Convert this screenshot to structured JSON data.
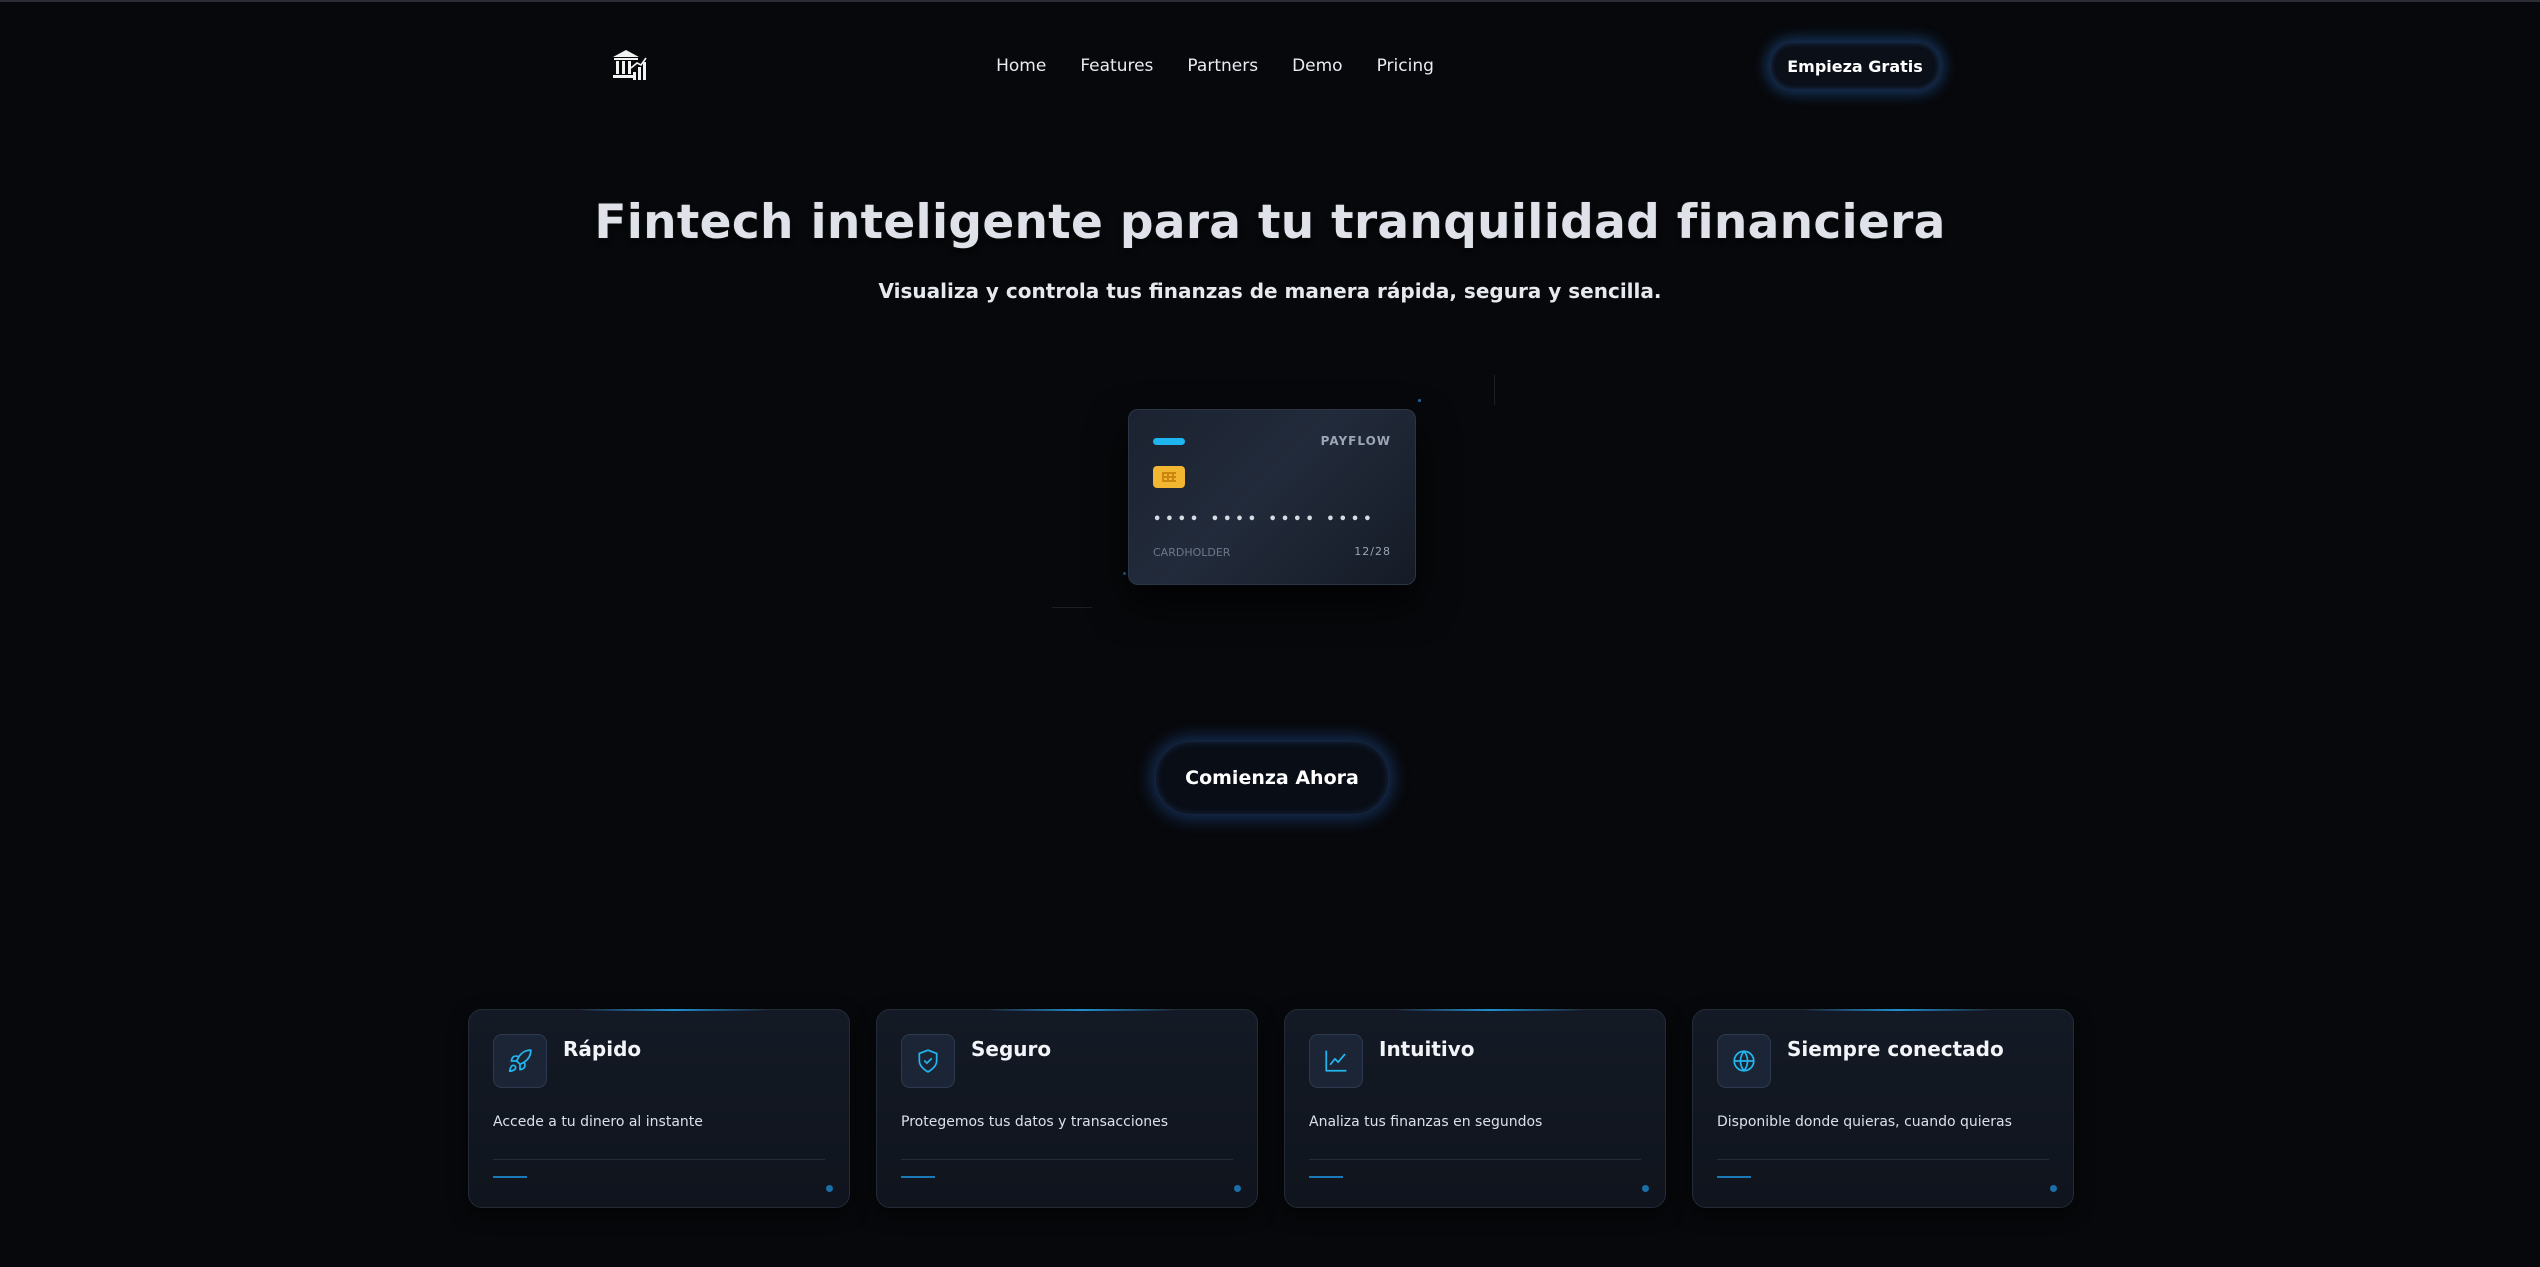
{
  "header": {
    "logo_icon": "bank-chart-icon",
    "nav": [
      "Home",
      "Features",
      "Partners",
      "Demo",
      "Pricing"
    ],
    "cta_label": "Empieza Gratis"
  },
  "hero": {
    "title": "Fintech inteligente para tu tranquilidad financiera",
    "subtitle": "Visualiza y controla tus finanzas de manera rápida, segura y sencilla."
  },
  "card": {
    "brand": "PAYFLOW",
    "number_masked": "•••• •••• •••• ••••",
    "holder": "CARDHOLDER",
    "expiry": "12/28",
    "strip_color": "#1fb6f0",
    "chip_color": "#f2b630"
  },
  "main_cta": {
    "label": "Comienza Ahora"
  },
  "features": [
    {
      "icon": "rocket-icon",
      "title": "Rápido",
      "description": "Accede a tu dinero al instante"
    },
    {
      "icon": "shield-check-icon",
      "title": "Seguro",
      "description": "Protegemos tus datos y transacciones"
    },
    {
      "icon": "line-chart-icon",
      "title": "Intuitivo",
      "description": "Analiza tus finanzas en segundos"
    },
    {
      "icon": "globe-icon",
      "title": "Siempre conectado",
      "description": "Disponible donde quieras, cuando quieras"
    }
  ],
  "colors": {
    "background": "#07080b",
    "accent": "#1fb6f0",
    "glow": "#2b6fc8"
  }
}
